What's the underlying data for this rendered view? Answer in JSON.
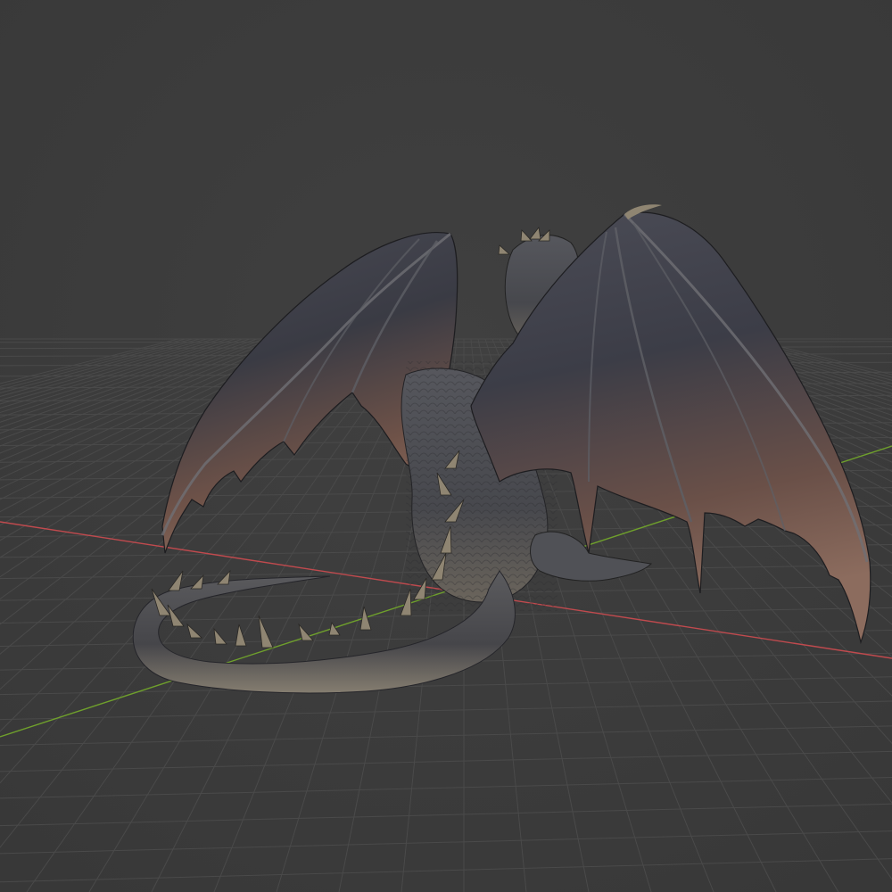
{
  "viewport": {
    "background": "#3d3d3d",
    "grid_color": "#4a4a4a",
    "x_axis_color": "#c04a4e",
    "y_axis_color": "#6fa02c",
    "object": "dragon"
  },
  "model": {
    "membrane_dark": "#3a3b44",
    "membrane_warm": "#7a5a4e",
    "scale_dark": "#3b3c40",
    "scale_light": "#8a8782",
    "spike_color": "#8f8572"
  }
}
